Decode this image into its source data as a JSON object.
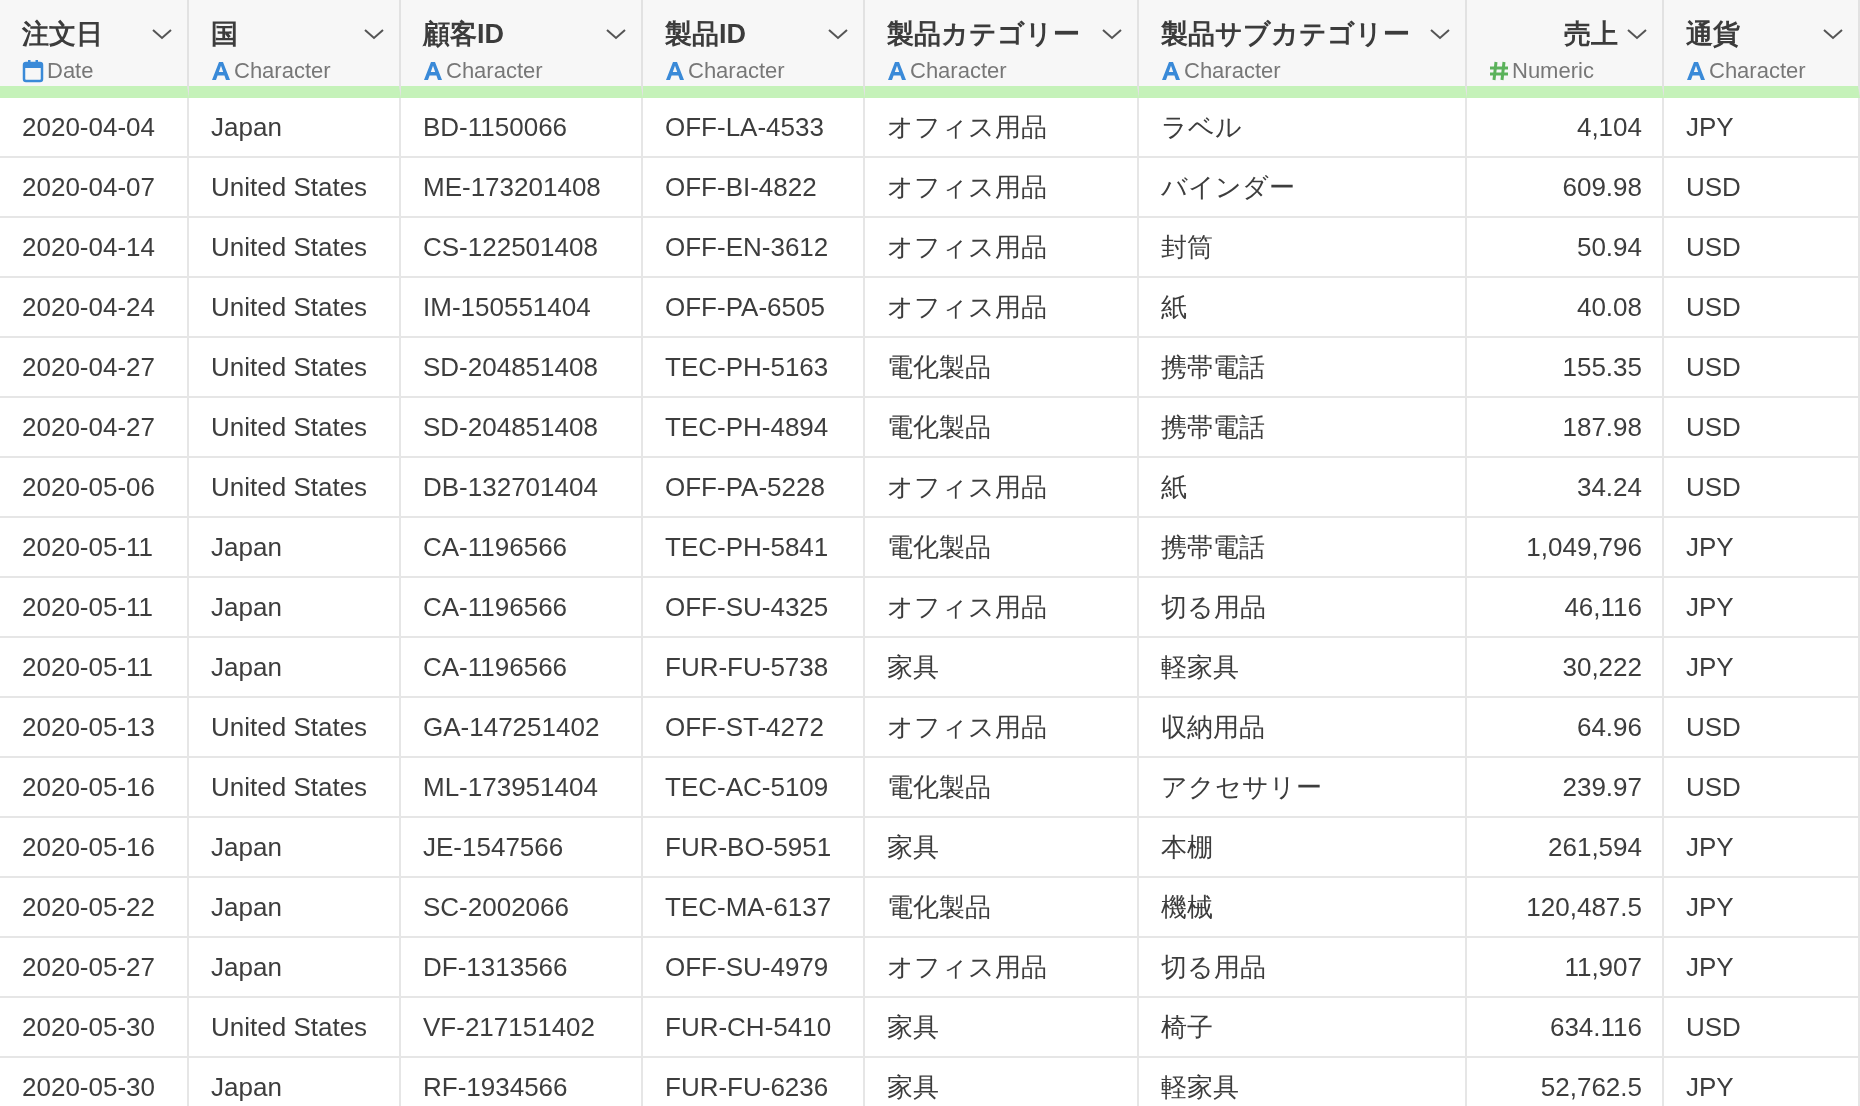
{
  "table": {
    "columns": [
      {
        "name": "注文日",
        "kind": "date",
        "type_label": "Date"
      },
      {
        "name": "国",
        "kind": "character",
        "type_label": "Character"
      },
      {
        "name": "顧客ID",
        "kind": "character",
        "type_label": "Character"
      },
      {
        "name": "製品ID",
        "kind": "character",
        "type_label": "Character"
      },
      {
        "name": "製品カテゴリー",
        "kind": "character",
        "type_label": "Character"
      },
      {
        "name": "製品サブカテゴリー",
        "kind": "character",
        "type_label": "Character"
      },
      {
        "name": "売上",
        "kind": "numeric",
        "type_label": "Numeric"
      },
      {
        "name": "通貨",
        "kind": "character",
        "type_label": "Character"
      }
    ],
    "rows": [
      [
        "2020-04-04",
        "Japan",
        "BD-1150066",
        "OFF-LA-4533",
        "オフィス用品",
        "ラベル",
        "4,104",
        "JPY"
      ],
      [
        "2020-04-07",
        "United States",
        "ME-173201408",
        "OFF-BI-4822",
        "オフィス用品",
        "バインダー",
        "609.98",
        "USD"
      ],
      [
        "2020-04-14",
        "United States",
        "CS-122501408",
        "OFF-EN-3612",
        "オフィス用品",
        "封筒",
        "50.94",
        "USD"
      ],
      [
        "2020-04-24",
        "United States",
        "IM-150551404",
        "OFF-PA-6505",
        "オフィス用品",
        "紙",
        "40.08",
        "USD"
      ],
      [
        "2020-04-27",
        "United States",
        "SD-204851408",
        "TEC-PH-5163",
        "電化製品",
        "携帯電話",
        "155.35",
        "USD"
      ],
      [
        "2020-04-27",
        "United States",
        "SD-204851408",
        "TEC-PH-4894",
        "電化製品",
        "携帯電話",
        "187.98",
        "USD"
      ],
      [
        "2020-05-06",
        "United States",
        "DB-132701404",
        "OFF-PA-5228",
        "オフィス用品",
        "紙",
        "34.24",
        "USD"
      ],
      [
        "2020-05-11",
        "Japan",
        "CA-1196566",
        "TEC-PH-5841",
        "電化製品",
        "携帯電話",
        "1,049,796",
        "JPY"
      ],
      [
        "2020-05-11",
        "Japan",
        "CA-1196566",
        "OFF-SU-4325",
        "オフィス用品",
        "切る用品",
        "46,116",
        "JPY"
      ],
      [
        "2020-05-11",
        "Japan",
        "CA-1196566",
        "FUR-FU-5738",
        "家具",
        "軽家具",
        "30,222",
        "JPY"
      ],
      [
        "2020-05-13",
        "United States",
        "GA-147251402",
        "OFF-ST-4272",
        "オフィス用品",
        "収納用品",
        "64.96",
        "USD"
      ],
      [
        "2020-05-16",
        "United States",
        "ML-173951404",
        "TEC-AC-5109",
        "電化製品",
        "アクセサリー",
        "239.97",
        "USD"
      ],
      [
        "2020-05-16",
        "Japan",
        "JE-1547566",
        "FUR-BO-5951",
        "家具",
        "本棚",
        "261,594",
        "JPY"
      ],
      [
        "2020-05-22",
        "Japan",
        "SC-2002066",
        "TEC-MA-6137",
        "電化製品",
        "機械",
        "120,487.5",
        "JPY"
      ],
      [
        "2020-05-27",
        "Japan",
        "DF-1313566",
        "OFF-SU-4979",
        "オフィス用品",
        "切る用品",
        "11,907",
        "JPY"
      ],
      [
        "2020-05-30",
        "United States",
        "VF-217151402",
        "FUR-CH-5410",
        "家具",
        "椅子",
        "634.116",
        "USD"
      ],
      [
        "2020-05-30",
        "Japan",
        "RF-1934566",
        "FUR-FU-6236",
        "家具",
        "軽家具",
        "52,762.5",
        "JPY"
      ]
    ]
  }
}
